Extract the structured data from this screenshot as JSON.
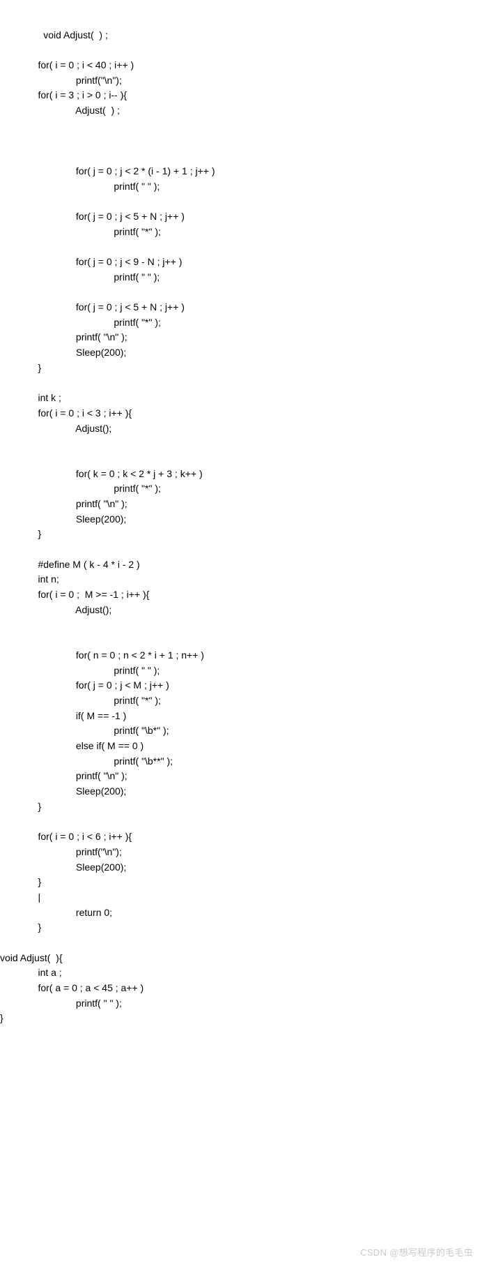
{
  "code": {
    "lines": [
      "              void Adjust(  ) ;",
      "",
      "              for( i = 0 ; i < 40 ; i++ )",
      "                            printf(\"\\n\");",
      "              for( i = 3 ; i > 0 ; i-- ){",
      "                            Adjust(  ) ;",
      "",
      "",
      "",
      "                            for( j = 0 ; j < 2 * (i - 1) + 1 ; j++ )",
      "                                          printf( \" \" );",
      "",
      "                            for( j = 0 ; j < 5 + N ; j++ )",
      "                                          printf( \"*\" );",
      "",
      "                            for( j = 0 ; j < 9 - N ; j++ )",
      "                                          printf( \" \" );",
      "",
      "                            for( j = 0 ; j < 5 + N ; j++ )",
      "                                          printf( \"*\" );",
      "                            printf( \"\\n\" );",
      "                            Sleep(200);",
      "              }",
      "",
      "              int k ;",
      "              for( i = 0 ; i < 3 ; i++ ){",
      "                            Adjust();",
      "",
      "",
      "                            for( k = 0 ; k < 2 * j + 3 ; k++ )",
      "                                          printf( \"*\" );",
      "                            printf( \"\\n\" );",
      "                            Sleep(200);",
      "              }",
      "",
      "              #define M ( k - 4 * i - 2 )",
      "              int n;",
      "              for( i = 0 ;  M >= -1 ; i++ ){",
      "                            Adjust();",
      "",
      "",
      "                            for( n = 0 ; n < 2 * i + 1 ; n++ )",
      "                                          printf( \" \" );",
      "                            for( j = 0 ; j < M ; j++ )",
      "                                          printf( \"*\" );",
      "                            if( M == -1 )",
      "                                          printf( \"\\b*\" );",
      "                            else if( M == 0 )",
      "                                          printf( \"\\b**\" );",
      "                            printf( \"\\n\" );",
      "                            Sleep(200);",
      "              }",
      "",
      "              for( i = 0 ; i < 6 ; i++ ){",
      "                            printf(\"\\n\");",
      "                            Sleep(200);",
      "              }",
      "              |",
      "                            return 0;",
      "              }",
      "",
      "void Adjust(  ){",
      "              int a ;",
      "              for( a = 0 ; a < 45 ; a++ )",
      "                            printf( \" \" );",
      "}"
    ]
  },
  "watermark": {
    "text": "CSDN @想写程序的毛毛虫"
  }
}
